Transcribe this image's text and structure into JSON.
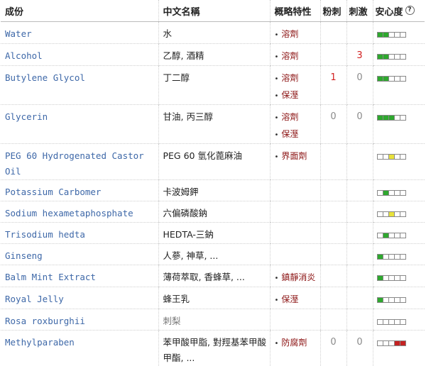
{
  "header": {
    "col_name": "成份",
    "col_cn": "中文名稱",
    "col_func": "概略特性",
    "col_acne": "粉刺",
    "col_irritation": "刺激",
    "col_safety": "安心度",
    "help_glyph": "?"
  },
  "rows": [
    {
      "name": "Water",
      "cn": "水",
      "func": [
        "溶劑"
      ],
      "acne": "",
      "irr": "",
      "safety": [
        1,
        1,
        0,
        0,
        0
      ],
      "safety_color": "green"
    },
    {
      "name": "Alcohol",
      "cn": "乙醇, 酒精",
      "func": [
        "溶劑"
      ],
      "acne": "",
      "irr": "3",
      "safety": [
        1,
        1,
        0,
        0,
        0
      ],
      "safety_color": "green"
    },
    {
      "name": "Butylene Glycol",
      "cn": "丁二醇",
      "func": [
        "溶劑",
        "保溼"
      ],
      "acne": "1",
      "irr": "0",
      "safety": [
        1,
        1,
        0,
        0,
        0
      ],
      "safety_color": "green"
    },
    {
      "name": "Glycerin",
      "cn": "甘油, 丙三醇",
      "func": [
        "溶劑",
        "保溼"
      ],
      "acne": "0",
      "irr": "0",
      "safety": [
        1,
        1,
        1,
        0,
        0
      ],
      "safety_color": "green"
    },
    {
      "name": "PEG 60 Hydrogenated Castor Oil",
      "cn": "PEG 60 氫化蓖麻油",
      "func": [
        "界面劑"
      ],
      "acne": "",
      "irr": "",
      "safety": [
        0,
        0,
        1,
        0,
        0
      ],
      "safety_color": "yellow"
    },
    {
      "name": "Potassium Carbomer",
      "cn": "卡波姆鉀",
      "func": [],
      "acne": "",
      "irr": "",
      "safety": [
        0,
        1,
        0,
        0,
        0
      ],
      "safety_color": "green"
    },
    {
      "name": "Sodium hexametaphosphate",
      "cn": "六偏磷酸鈉",
      "func": [],
      "acne": "",
      "irr": "",
      "safety": [
        0,
        0,
        1,
        0,
        0
      ],
      "safety_color": "yellow"
    },
    {
      "name": "Trisodium hedta",
      "cn": "HEDTA-三鈉",
      "func": [],
      "acne": "",
      "irr": "",
      "safety": [
        0,
        1,
        0,
        0,
        0
      ],
      "safety_color": "green"
    },
    {
      "name": "Ginseng",
      "cn": "人蔘, 神草, ...",
      "func": [],
      "acne": "",
      "irr": "",
      "safety": [
        1,
        0,
        0,
        0,
        0
      ],
      "safety_color": "green"
    },
    {
      "name": "Balm Mint Extract",
      "cn": "薄荷萃取, 香蜂草, ...",
      "func": [
        "鎮靜消炎"
      ],
      "acne": "",
      "irr": "",
      "safety": [
        1,
        0,
        0,
        0,
        0
      ],
      "safety_color": "green"
    },
    {
      "name": "Royal Jelly",
      "cn": "蜂王乳",
      "func": [
        "保溼"
      ],
      "acne": "",
      "irr": "",
      "safety": [
        1,
        0,
        0,
        0,
        0
      ],
      "safety_color": "green"
    },
    {
      "name": "Rosa roxburghii",
      "cn": "刺梨",
      "cn_italic": true,
      "func": [],
      "acne": "",
      "irr": "",
      "safety": [
        0,
        0,
        0,
        0,
        0
      ],
      "safety_color": "none"
    },
    {
      "name": "Methylparaben",
      "cn": "苯甲酸甲脂, 對羥基苯甲酸甲酯, ...",
      "func": [
        "防腐劑"
      ],
      "acne": "0",
      "irr": "0",
      "safety": [
        0,
        0,
        0,
        1,
        1
      ],
      "safety_color": "red"
    }
  ]
}
